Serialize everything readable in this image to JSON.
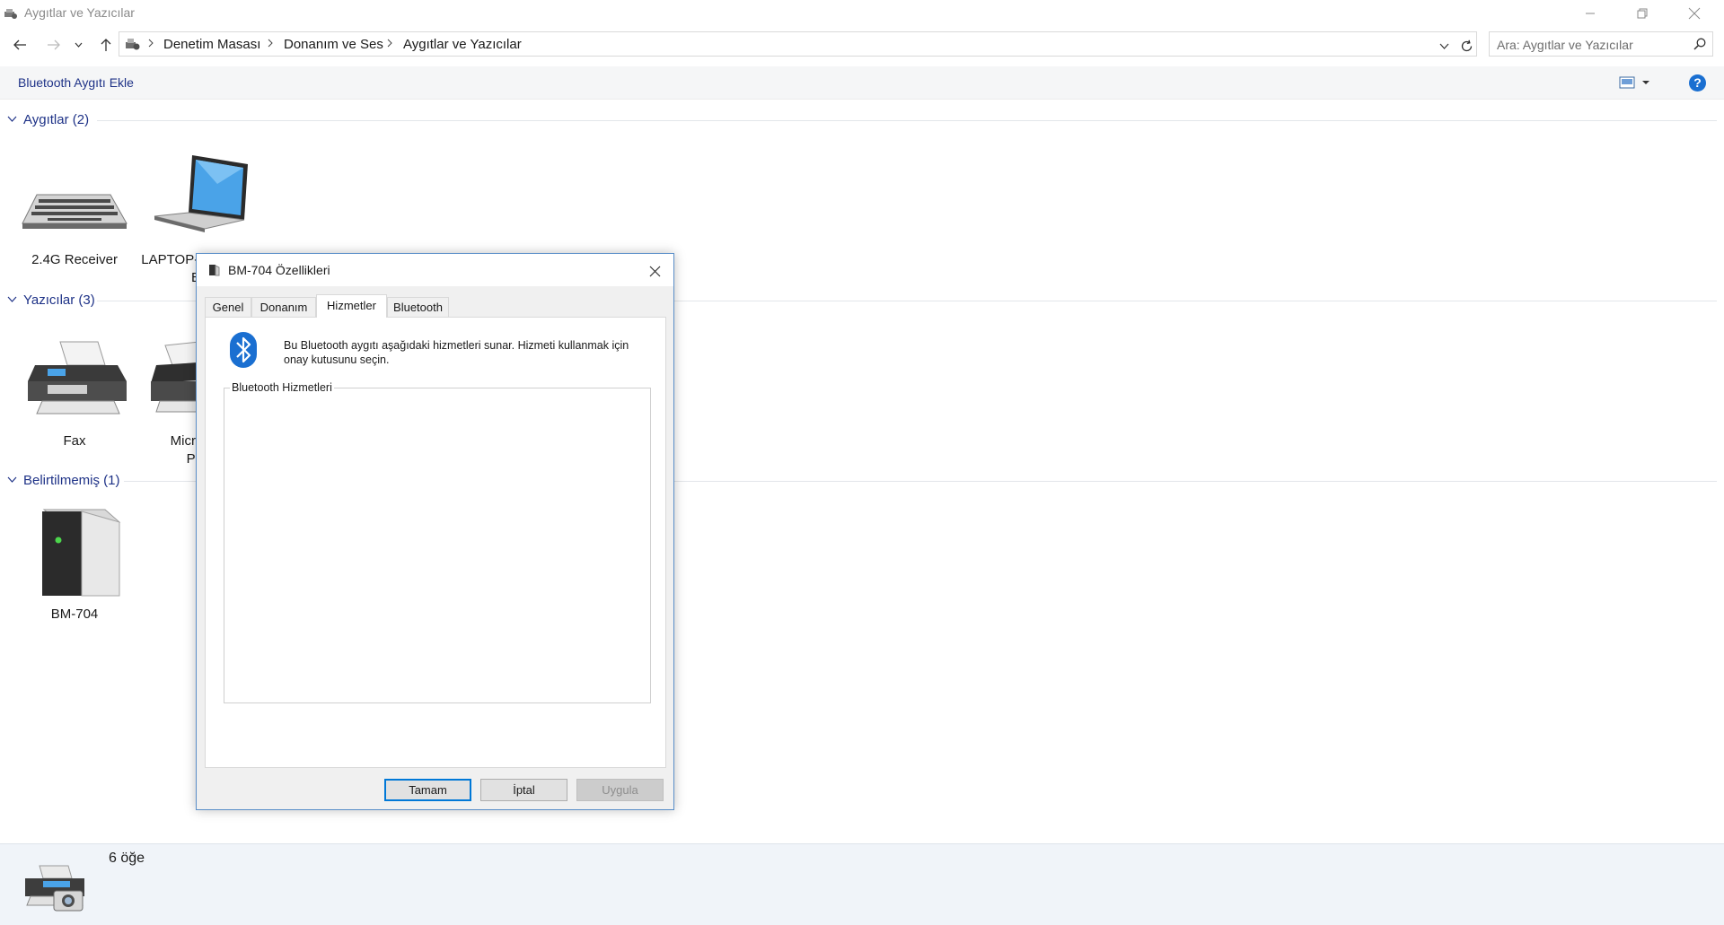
{
  "window": {
    "title": "Aygıtlar ve Yazıcılar"
  },
  "breadcrumb": [
    "Denetim Masası",
    "Donanım ve Ses",
    "Aygıtlar ve Yazıcılar"
  ],
  "search": {
    "placeholder": "Ara: Aygıtlar ve Yazıcılar"
  },
  "toolbar": {
    "add_bluetooth": "Bluetooth Aygıtı Ekle",
    "help_label": "?"
  },
  "groups": {
    "devices": {
      "title": "Aygıtlar (2)",
      "items": [
        {
          "name": "2.4G Receiver",
          "icon": "keyboard-icon"
        },
        {
          "name": "LAPTOP-IHOHOL",
          "name_line2": "B",
          "icon": "laptop-icon"
        }
      ]
    },
    "printers": {
      "title": "Yazıcılar (3)",
      "items": [
        {
          "name": "Fax",
          "icon": "fax-printer-icon"
        },
        {
          "name": "Microsof",
          "name_line2": "PD",
          "icon": "printer-icon"
        }
      ]
    },
    "unspecified": {
      "title": "Belirtilmemiş (1)",
      "items": [
        {
          "name": "BM-704",
          "icon": "tower-device-icon"
        }
      ]
    }
  },
  "status": {
    "item_count": "6 öğe"
  },
  "dialog": {
    "title": "BM-704 Özellikleri",
    "tabs": [
      "Genel",
      "Donanım",
      "Hizmetler",
      "Bluetooth"
    ],
    "active_tab": "Hizmetler",
    "info_text": "Bu Bluetooth aygıtı aşağıdaki hizmetleri sunar. Hizmeti kullanmak için onay kutusunu seçin.",
    "services_legend": "Bluetooth Hizmetleri",
    "buttons": {
      "ok": "Tamam",
      "cancel": "İptal",
      "apply": "Uygula"
    }
  },
  "colors": {
    "accent": "#0078d7",
    "link": "#1e3287",
    "help": "#1a6fd1",
    "dialog_border": "#5b8fc9"
  }
}
